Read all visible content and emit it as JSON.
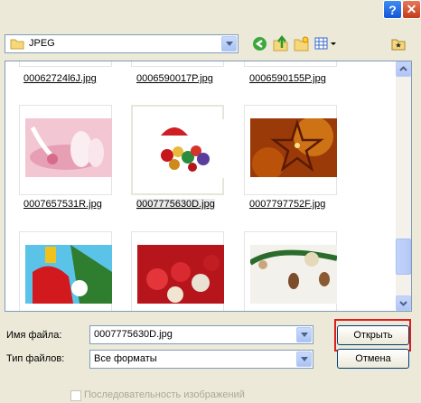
{
  "title_bar": {
    "help_glyph": "?",
    "close_glyph": "✕"
  },
  "toolbar": {
    "folder_name": "JPEG",
    "icons": [
      "folder-icon",
      "back-icon",
      "up-folder-icon",
      "new-folder-icon",
      "views-menu-icon",
      "favorites-icon"
    ]
  },
  "files": {
    "row0": [
      "00062724l6J.jpg",
      "0006590017P.jpg",
      "0006590155P.jpg"
    ],
    "row1": [
      "0007657531R.jpg",
      "0007775630D.jpg",
      "0007797752F.jpg"
    ],
    "row2": [
      "",
      "",
      ""
    ],
    "selected": "0007775630D.jpg"
  },
  "form": {
    "filename_label": "Имя файла:",
    "filename_value": "0007775630D.jpg",
    "filetype_label": "Тип файлов:",
    "filetype_value": "Все форматы",
    "open_button": "Открыть",
    "cancel_button": "Отмена",
    "sequence_label": "Последовательность изображений"
  },
  "colors": {
    "highlight_box": "#e01c1c"
  }
}
